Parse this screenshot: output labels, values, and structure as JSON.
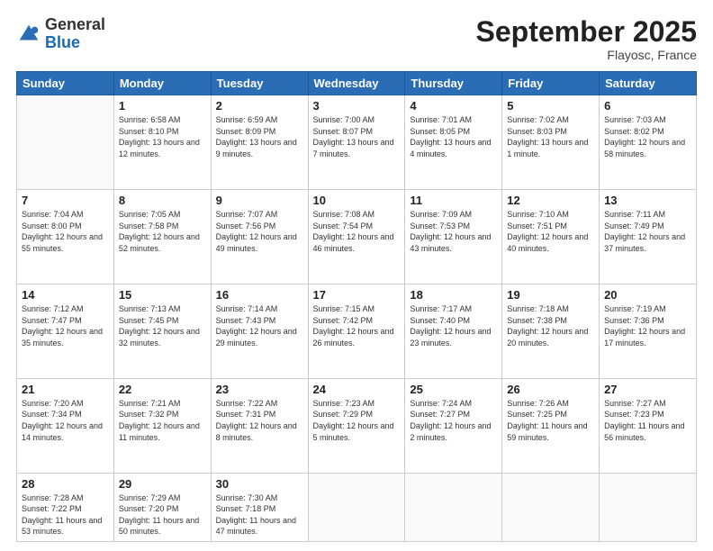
{
  "logo": {
    "general": "General",
    "blue": "Blue"
  },
  "header": {
    "title": "September 2025",
    "location": "Flayosc, France"
  },
  "days_of_week": [
    "Sunday",
    "Monday",
    "Tuesday",
    "Wednesday",
    "Thursday",
    "Friday",
    "Saturday"
  ],
  "weeks": [
    [
      {
        "day": "",
        "sunrise": "",
        "sunset": "",
        "daylight": ""
      },
      {
        "day": "1",
        "sunrise": "Sunrise: 6:58 AM",
        "sunset": "Sunset: 8:10 PM",
        "daylight": "Daylight: 13 hours and 12 minutes."
      },
      {
        "day": "2",
        "sunrise": "Sunrise: 6:59 AM",
        "sunset": "Sunset: 8:09 PM",
        "daylight": "Daylight: 13 hours and 9 minutes."
      },
      {
        "day": "3",
        "sunrise": "Sunrise: 7:00 AM",
        "sunset": "Sunset: 8:07 PM",
        "daylight": "Daylight: 13 hours and 7 minutes."
      },
      {
        "day": "4",
        "sunrise": "Sunrise: 7:01 AM",
        "sunset": "Sunset: 8:05 PM",
        "daylight": "Daylight: 13 hours and 4 minutes."
      },
      {
        "day": "5",
        "sunrise": "Sunrise: 7:02 AM",
        "sunset": "Sunset: 8:03 PM",
        "daylight": "Daylight: 13 hours and 1 minute."
      },
      {
        "day": "6",
        "sunrise": "Sunrise: 7:03 AM",
        "sunset": "Sunset: 8:02 PM",
        "daylight": "Daylight: 12 hours and 58 minutes."
      }
    ],
    [
      {
        "day": "7",
        "sunrise": "Sunrise: 7:04 AM",
        "sunset": "Sunset: 8:00 PM",
        "daylight": "Daylight: 12 hours and 55 minutes."
      },
      {
        "day": "8",
        "sunrise": "Sunrise: 7:05 AM",
        "sunset": "Sunset: 7:58 PM",
        "daylight": "Daylight: 12 hours and 52 minutes."
      },
      {
        "day": "9",
        "sunrise": "Sunrise: 7:07 AM",
        "sunset": "Sunset: 7:56 PM",
        "daylight": "Daylight: 12 hours and 49 minutes."
      },
      {
        "day": "10",
        "sunrise": "Sunrise: 7:08 AM",
        "sunset": "Sunset: 7:54 PM",
        "daylight": "Daylight: 12 hours and 46 minutes."
      },
      {
        "day": "11",
        "sunrise": "Sunrise: 7:09 AM",
        "sunset": "Sunset: 7:53 PM",
        "daylight": "Daylight: 12 hours and 43 minutes."
      },
      {
        "day": "12",
        "sunrise": "Sunrise: 7:10 AM",
        "sunset": "Sunset: 7:51 PM",
        "daylight": "Daylight: 12 hours and 40 minutes."
      },
      {
        "day": "13",
        "sunrise": "Sunrise: 7:11 AM",
        "sunset": "Sunset: 7:49 PM",
        "daylight": "Daylight: 12 hours and 37 minutes."
      }
    ],
    [
      {
        "day": "14",
        "sunrise": "Sunrise: 7:12 AM",
        "sunset": "Sunset: 7:47 PM",
        "daylight": "Daylight: 12 hours and 35 minutes."
      },
      {
        "day": "15",
        "sunrise": "Sunrise: 7:13 AM",
        "sunset": "Sunset: 7:45 PM",
        "daylight": "Daylight: 12 hours and 32 minutes."
      },
      {
        "day": "16",
        "sunrise": "Sunrise: 7:14 AM",
        "sunset": "Sunset: 7:43 PM",
        "daylight": "Daylight: 12 hours and 29 minutes."
      },
      {
        "day": "17",
        "sunrise": "Sunrise: 7:15 AM",
        "sunset": "Sunset: 7:42 PM",
        "daylight": "Daylight: 12 hours and 26 minutes."
      },
      {
        "day": "18",
        "sunrise": "Sunrise: 7:17 AM",
        "sunset": "Sunset: 7:40 PM",
        "daylight": "Daylight: 12 hours and 23 minutes."
      },
      {
        "day": "19",
        "sunrise": "Sunrise: 7:18 AM",
        "sunset": "Sunset: 7:38 PM",
        "daylight": "Daylight: 12 hours and 20 minutes."
      },
      {
        "day": "20",
        "sunrise": "Sunrise: 7:19 AM",
        "sunset": "Sunset: 7:36 PM",
        "daylight": "Daylight: 12 hours and 17 minutes."
      }
    ],
    [
      {
        "day": "21",
        "sunrise": "Sunrise: 7:20 AM",
        "sunset": "Sunset: 7:34 PM",
        "daylight": "Daylight: 12 hours and 14 minutes."
      },
      {
        "day": "22",
        "sunrise": "Sunrise: 7:21 AM",
        "sunset": "Sunset: 7:32 PM",
        "daylight": "Daylight: 12 hours and 11 minutes."
      },
      {
        "day": "23",
        "sunrise": "Sunrise: 7:22 AM",
        "sunset": "Sunset: 7:31 PM",
        "daylight": "Daylight: 12 hours and 8 minutes."
      },
      {
        "day": "24",
        "sunrise": "Sunrise: 7:23 AM",
        "sunset": "Sunset: 7:29 PM",
        "daylight": "Daylight: 12 hours and 5 minutes."
      },
      {
        "day": "25",
        "sunrise": "Sunrise: 7:24 AM",
        "sunset": "Sunset: 7:27 PM",
        "daylight": "Daylight: 12 hours and 2 minutes."
      },
      {
        "day": "26",
        "sunrise": "Sunrise: 7:26 AM",
        "sunset": "Sunset: 7:25 PM",
        "daylight": "Daylight: 11 hours and 59 minutes."
      },
      {
        "day": "27",
        "sunrise": "Sunrise: 7:27 AM",
        "sunset": "Sunset: 7:23 PM",
        "daylight": "Daylight: 11 hours and 56 minutes."
      }
    ],
    [
      {
        "day": "28",
        "sunrise": "Sunrise: 7:28 AM",
        "sunset": "Sunset: 7:22 PM",
        "daylight": "Daylight: 11 hours and 53 minutes."
      },
      {
        "day": "29",
        "sunrise": "Sunrise: 7:29 AM",
        "sunset": "Sunset: 7:20 PM",
        "daylight": "Daylight: 11 hours and 50 minutes."
      },
      {
        "day": "30",
        "sunrise": "Sunrise: 7:30 AM",
        "sunset": "Sunset: 7:18 PM",
        "daylight": "Daylight: 11 hours and 47 minutes."
      },
      {
        "day": "",
        "sunrise": "",
        "sunset": "",
        "daylight": ""
      },
      {
        "day": "",
        "sunrise": "",
        "sunset": "",
        "daylight": ""
      },
      {
        "day": "",
        "sunrise": "",
        "sunset": "",
        "daylight": ""
      },
      {
        "day": "",
        "sunrise": "",
        "sunset": "",
        "daylight": ""
      }
    ]
  ]
}
